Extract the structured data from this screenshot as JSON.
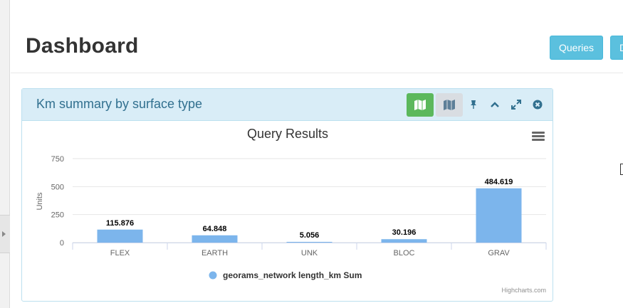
{
  "page": {
    "title": "Dashboard",
    "buttons": {
      "queries": "Queries",
      "second": "D"
    }
  },
  "panel": {
    "title": "Km summary by surface type",
    "icons": [
      "map-icon",
      "map-icon",
      "pin-icon",
      "chevron-up-icon",
      "expand-icon",
      "close-circle-icon"
    ]
  },
  "chart_data": {
    "type": "bar",
    "title": "Query Results",
    "ylabel": "Units",
    "xlabel": "",
    "categories": [
      "FLEX",
      "EARTH",
      "UNK",
      "BLOC",
      "GRAV"
    ],
    "series": [
      {
        "name": "georams_network length_km Sum",
        "values": [
          115.876,
          64.848,
          5.056,
          30.196,
          484.619
        ],
        "color": "#7cb5ec"
      }
    ],
    "yticks": [
      0,
      250,
      500,
      750
    ],
    "ylim": [
      0,
      750
    ],
    "legend_position": "bottom-center",
    "grid": true,
    "credits": "Highcharts.com"
  },
  "colors": {
    "accent_info": "#5bc0de",
    "panel_header_bg": "#d9edf7",
    "success": "#5cb85c",
    "bar": "#7cb5ec"
  }
}
